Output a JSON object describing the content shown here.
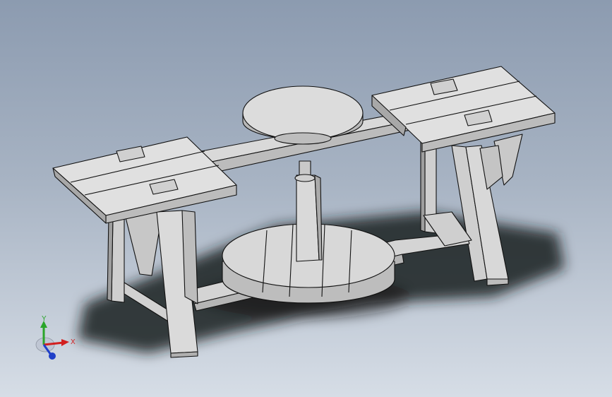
{
  "view": {
    "background_top": "#8c9bb0",
    "background_bottom": "#d6dde6",
    "part_fill": "#d8d8d8",
    "part_dark": "#a9a9a9",
    "edge_color": "#111111"
  },
  "triad": {
    "x_label": "X",
    "y_label": "Y",
    "x_color": "#d21f1f",
    "y_color": "#2aa52a",
    "z_color": "#1f3fc8"
  }
}
